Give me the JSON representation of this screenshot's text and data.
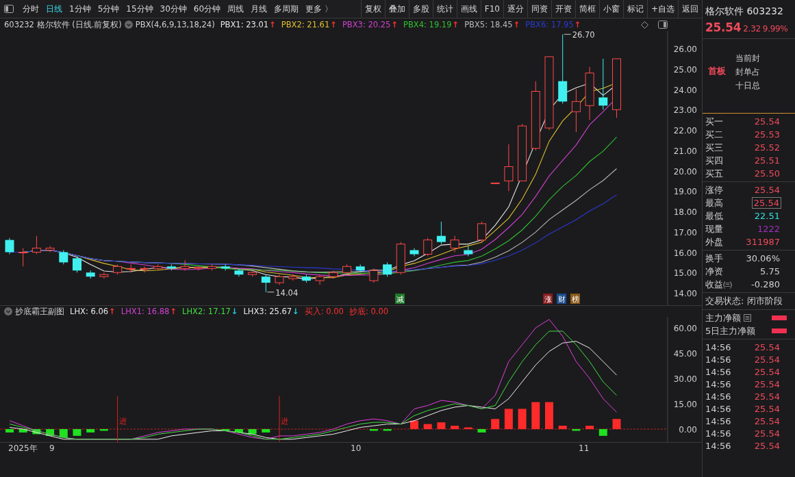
{
  "toolbar": {
    "periods": [
      {
        "label": "分时",
        "selected": false
      },
      {
        "label": "日线",
        "selected": true
      },
      {
        "label": "1分钟",
        "selected": false
      },
      {
        "label": "5分钟",
        "selected": false
      },
      {
        "label": "15分钟",
        "selected": false
      },
      {
        "label": "30分钟",
        "selected": false
      },
      {
        "label": "60分钟",
        "selected": false
      },
      {
        "label": "周线",
        "selected": false
      },
      {
        "label": "月线",
        "selected": false
      },
      {
        "label": "多周期",
        "selected": false
      },
      {
        "label": "更多 〉",
        "selected": false
      }
    ],
    "buttons": [
      "复权",
      "叠加",
      "多股",
      "统计",
      "画线",
      "F10",
      "逐分",
      "同资",
      "开资",
      "简框",
      "小窗",
      "标记",
      "+自选",
      "返回"
    ]
  },
  "main_chart": {
    "title": "603232 格尔软件 (日线.前复权)",
    "indicator": "PBX(4,6,9,13,18,24)",
    "legend": [
      {
        "label": "PBX1: 23.01",
        "color": "#e8e8e8",
        "arrow": {
          "symbol": "↑",
          "color": "#ff3030"
        }
      },
      {
        "label": "PBX2: 21.61",
        "color": "#e0c030",
        "arrow": {
          "symbol": "↑",
          "color": "#ff3030"
        }
      },
      {
        "label": "PBX3: 20.25",
        "color": "#d040d0",
        "arrow": {
          "symbol": "↑",
          "color": "#ff3030"
        }
      },
      {
        "label": "PBX4: 19.19",
        "color": "#30c030",
        "arrow": {
          "symbol": "↑",
          "color": "#ff3030"
        }
      },
      {
        "label": "PBX5: 18.45",
        "color": "#b8b8b8",
        "arrow": {
          "symbol": "↑",
          "color": "#ff3030"
        }
      },
      {
        "label": "PBX6: 17.95",
        "color": "#2a3ad0",
        "arrow": {
          "symbol": "↑",
          "color": "#ff3030"
        }
      }
    ],
    "y_axis": [
      "26.00",
      "25.00",
      "24.00",
      "23.00",
      "22.00",
      "21.00",
      "20.00",
      "19.00",
      "18.00",
      "17.00",
      "16.00",
      "15.00",
      "14.00"
    ],
    "high_label": "26.70",
    "low_label": "14.04",
    "tags": [
      {
        "label": "减",
        "color": "#1f7a2a"
      },
      {
        "label": "涨",
        "color": "#8a1c20"
      },
      {
        "label": "财",
        "color": "#1c4c8a"
      },
      {
        "label": "榜",
        "color": "#8a5a1c"
      }
    ]
  },
  "sub_chart": {
    "title": "抄底霸王副图",
    "legend": [
      {
        "label": "LHX: 6.06",
        "color": "#e8e8e8",
        "arrow": {
          "symbol": "↑",
          "color": "#ff3030"
        }
      },
      {
        "label": "LHX1: 16.88",
        "color": "#d040d0",
        "arrow": {
          "symbol": "↑",
          "color": "#ff3030"
        }
      },
      {
        "label": "LHX2: 17.17",
        "color": "#40e040",
        "arrow": {
          "symbol": "↓",
          "color": "#20d0e0"
        }
      },
      {
        "label": "LHX3: 25.67",
        "color": "#e8e8e8",
        "arrow": {
          "symbol": "↓",
          "color": "#20d0e0"
        }
      },
      {
        "label": "买入: 0.00",
        "color": "#ff3030"
      },
      {
        "label": "抄底: 0.00",
        "color": "#ff3030"
      }
    ],
    "y_axis": [
      "60.00",
      "45.00",
      "30.00",
      "15.00",
      "0.00"
    ],
    "signals": [
      "进",
      "进"
    ]
  },
  "date_axis": [
    "2025年",
    "9",
    "10",
    "11"
  ],
  "quote": {
    "name": "格尔软件 603232",
    "price": "25.54",
    "change": "2.32",
    "percent": "9.99%",
    "badge": "首板",
    "notes": [
      "当前封",
      "封单占",
      "十日总"
    ],
    "bids": [
      {
        "label": "买一",
        "value": "25.54"
      },
      {
        "label": "买二",
        "value": "25.53"
      },
      {
        "label": "买三",
        "value": "25.52"
      },
      {
        "label": "买四",
        "value": "25.51"
      },
      {
        "label": "买五",
        "value": "25.50"
      }
    ],
    "stats": [
      {
        "label": "涨停",
        "value": "25.54",
        "color": "#f04a5a",
        "boxed": false
      },
      {
        "label": "最高",
        "value": "25.54",
        "color": "#f04a5a",
        "boxed": true
      },
      {
        "label": "最低",
        "value": "22.51",
        "color": "#30e0d8",
        "boxed": false
      },
      {
        "label": "现量",
        "value": "1222",
        "color": "#a030c0",
        "boxed": false
      },
      {
        "label": "外盘",
        "value": "311987",
        "color": "#f04a5a",
        "boxed": false
      }
    ],
    "fundamentals": [
      {
        "label": "换手",
        "value": "30.06%"
      },
      {
        "label": "净资",
        "value": "5.75"
      },
      {
        "label": "收益㈢",
        "value": "-0.280"
      }
    ],
    "status": "交易状态: 闭市阶段",
    "flows": [
      {
        "label": "主力净额",
        "icon": true
      },
      {
        "label": "5日主力净额",
        "icon": false
      }
    ],
    "ticks": [
      {
        "time": "14:56",
        "price": "25.54"
      },
      {
        "time": "14:56",
        "price": "25.54"
      },
      {
        "time": "14:56",
        "price": "25.54"
      },
      {
        "time": "14:56",
        "price": "25.54"
      },
      {
        "time": "14:56",
        "price": "25.54"
      },
      {
        "time": "14:56",
        "price": "25.54"
      },
      {
        "time": "14:56",
        "price": "25.54"
      },
      {
        "time": "14:56",
        "price": "25.54"
      },
      {
        "time": "14:56",
        "price": "25.54"
      }
    ]
  }
}
